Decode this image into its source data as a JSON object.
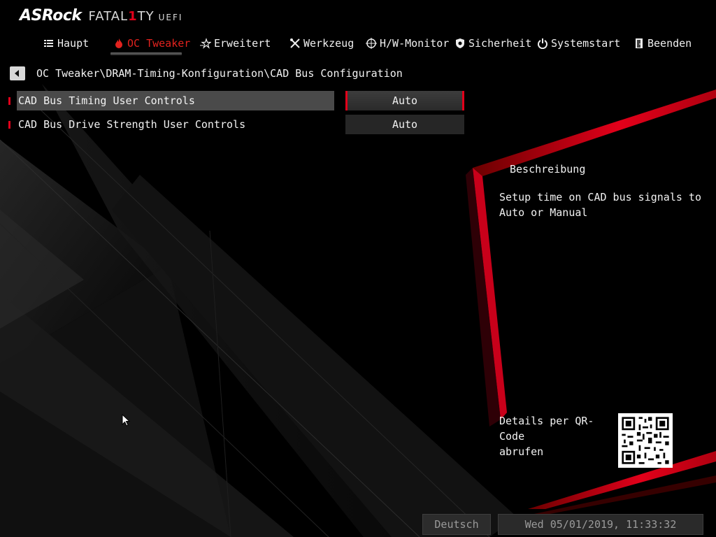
{
  "brand": {
    "name": "ASRock",
    "line": "FATAL1TY",
    "line_left": "FATAL",
    "line_one": "1",
    "line_right": "TY",
    "uefi": "UEFI"
  },
  "nav": {
    "tabs": [
      {
        "label": "Haupt",
        "icon": "list-icon"
      },
      {
        "label": "OC Tweaker",
        "icon": "flame-icon",
        "active": true
      },
      {
        "label": "Erweitert",
        "icon": "star-icon"
      },
      {
        "label": "Werkzeug",
        "icon": "tools-icon"
      },
      {
        "label": "H/W-Monitor",
        "icon": "crosshair-icon"
      },
      {
        "label": "Sicherheit",
        "icon": "shield-icon"
      },
      {
        "label": "Systemstart",
        "icon": "power-icon"
      },
      {
        "label": "Beenden",
        "icon": "exit-door-icon"
      }
    ]
  },
  "breadcrumb": {
    "path": "OC Tweaker\\DRAM-Timing-Konfiguration\\CAD Bus Configuration"
  },
  "settings": [
    {
      "label": "CAD Bus Timing User Controls",
      "value": "Auto",
      "selected": true
    },
    {
      "label": "CAD Bus Drive Strength User Controls",
      "value": "Auto",
      "selected": false
    }
  ],
  "description": {
    "title": "Beschreibung",
    "line1": "Setup time on CAD bus signals to",
    "line2": "Auto or Manual"
  },
  "qr": {
    "line1": "Details per QR-Code",
    "line2": "abrufen"
  },
  "footer": {
    "language": "Deutsch",
    "datetime": "Wed 05/01/2019, 11:33:32"
  },
  "colors": {
    "accent": "#e2001a",
    "active_tab": "#e2221e",
    "selected_row": "#4a4a4a",
    "background": "#000000"
  }
}
